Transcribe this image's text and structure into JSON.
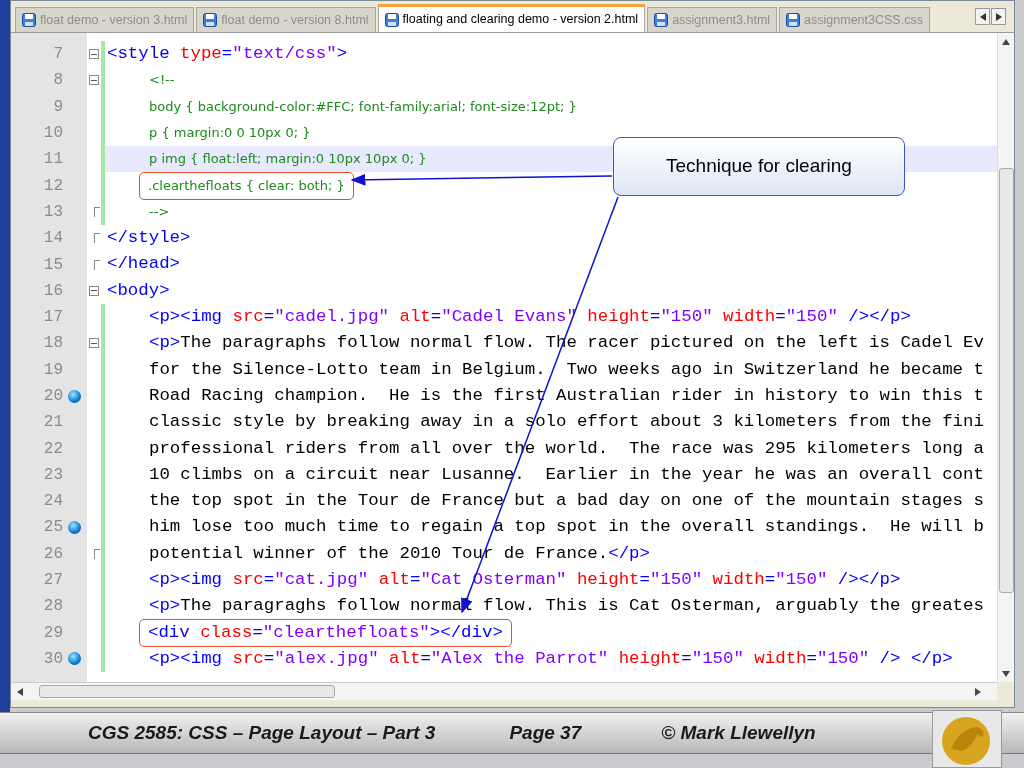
{
  "tabs": [
    {
      "label": "float demo - version 3.html",
      "selected": false
    },
    {
      "label": "float demo - version 8.html",
      "selected": false
    },
    {
      "label": "floating and clearing demo - version 2.html",
      "selected": true
    },
    {
      "label": "assignment3.html",
      "selected": false
    },
    {
      "label": "assignment3CSS.css",
      "selected": false
    }
  ],
  "lines": [
    {
      "number": "7",
      "fold_start": true,
      "fold_end": false,
      "bookmark": false,
      "changed": true,
      "current": false,
      "boxed": false,
      "indented": false,
      "tokens": [
        {
          "kind": "tag",
          "text": "<style "
        },
        {
          "kind": "attr",
          "text": "type"
        },
        {
          "kind": "tag",
          "text": "="
        },
        {
          "kind": "value",
          "text": "\"text/css\""
        },
        {
          "kind": "tag",
          "text": ">"
        }
      ]
    },
    {
      "number": "8",
      "fold_start": true,
      "fold_end": false,
      "bookmark": false,
      "changed": true,
      "current": false,
      "boxed": false,
      "indented": true,
      "tokens": [
        {
          "kind": "css",
          "text": "<!--"
        }
      ]
    },
    {
      "number": "9",
      "fold_start": false,
      "fold_end": false,
      "bookmark": false,
      "changed": true,
      "current": false,
      "boxed": false,
      "indented": true,
      "tokens": [
        {
          "kind": "css",
          "text": "body { background-color:#FFC; font-family:arial; font-size:12pt; }"
        }
      ]
    },
    {
      "number": "10",
      "fold_start": false,
      "fold_end": false,
      "bookmark": false,
      "changed": true,
      "current": false,
      "boxed": false,
      "indented": true,
      "tokens": [
        {
          "kind": "css",
          "text": "p { margin:0 0 10px 0; }"
        }
      ]
    },
    {
      "number": "11",
      "fold_start": false,
      "fold_end": false,
      "bookmark": false,
      "changed": true,
      "current": true,
      "boxed": false,
      "indented": true,
      "tokens": [
        {
          "kind": "css",
          "text": "p img { float:left; margin:0 10px 10px 0; }"
        }
      ]
    },
    {
      "number": "12",
      "fold_start": false,
      "fold_end": false,
      "bookmark": false,
      "changed": true,
      "current": false,
      "boxed": true,
      "indented": true,
      "tokens": [
        {
          "kind": "css",
          "text": ".clearthefloats { clear: both; }"
        }
      ]
    },
    {
      "number": "13",
      "fold_start": false,
      "fold_end": true,
      "bookmark": false,
      "changed": true,
      "current": false,
      "boxed": false,
      "indented": true,
      "tokens": [
        {
          "kind": "css",
          "text": "-->"
        }
      ]
    },
    {
      "number": "14",
      "fold_start": false,
      "fold_end": true,
      "bookmark": false,
      "changed": false,
      "current": false,
      "boxed": false,
      "indented": false,
      "tokens": [
        {
          "kind": "tag",
          "text": "</style>"
        }
      ]
    },
    {
      "number": "15",
      "fold_start": false,
      "fold_end": true,
      "bookmark": false,
      "changed": false,
      "current": false,
      "boxed": false,
      "indented": false,
      "tokens": [
        {
          "kind": "tag",
          "text": "</head>"
        }
      ]
    },
    {
      "number": "16",
      "fold_start": true,
      "fold_end": false,
      "bookmark": false,
      "changed": false,
      "current": false,
      "boxed": false,
      "indented": false,
      "tokens": [
        {
          "kind": "tag",
          "text": "<body>"
        }
      ]
    },
    {
      "number": "17",
      "fold_start": false,
      "fold_end": false,
      "bookmark": false,
      "changed": true,
      "current": false,
      "boxed": false,
      "indented": true,
      "tokens": [
        {
          "kind": "tag",
          "text": "<p><img "
        },
        {
          "kind": "attr",
          "text": "src"
        },
        {
          "kind": "tag",
          "text": "="
        },
        {
          "kind": "value",
          "text": "\"cadel.jpg\" "
        },
        {
          "kind": "attr",
          "text": "alt"
        },
        {
          "kind": "tag",
          "text": "="
        },
        {
          "kind": "value",
          "text": "\"Cadel Evans\" "
        },
        {
          "kind": "attr",
          "text": "height"
        },
        {
          "kind": "tag",
          "text": "="
        },
        {
          "kind": "value",
          "text": "\"150\" "
        },
        {
          "kind": "attr",
          "text": "width"
        },
        {
          "kind": "tag",
          "text": "="
        },
        {
          "kind": "value",
          "text": "\"150\" "
        },
        {
          "kind": "tag",
          "text": "/></p>"
        }
      ]
    },
    {
      "number": "18",
      "fold_start": true,
      "fold_end": false,
      "bookmark": false,
      "changed": true,
      "current": false,
      "boxed": false,
      "indented": true,
      "tokens": [
        {
          "kind": "tag",
          "text": "<p>"
        },
        {
          "kind": "text",
          "text": "The paragraphs follow normal flow. The racer pictured on the left is Cadel Ev"
        }
      ]
    },
    {
      "number": "19",
      "fold_start": false,
      "fold_end": false,
      "bookmark": false,
      "changed": true,
      "current": false,
      "boxed": false,
      "indented": true,
      "tokens": [
        {
          "kind": "text",
          "text": "for the Silence-Lotto team in Belgium.  Two weeks ago in Switzerland he became t"
        }
      ]
    },
    {
      "number": "20",
      "fold_start": false,
      "fold_end": false,
      "bookmark": true,
      "changed": true,
      "current": false,
      "boxed": false,
      "indented": true,
      "tokens": [
        {
          "kind": "text",
          "text": "Road Racing champion.  He is the first Australian rider in history to win this t"
        }
      ]
    },
    {
      "number": "21",
      "fold_start": false,
      "fold_end": false,
      "bookmark": false,
      "changed": true,
      "current": false,
      "boxed": false,
      "indented": true,
      "tokens": [
        {
          "kind": "text",
          "text": "classic style by breaking away in a solo effort about 3 kilometers from the fini"
        }
      ]
    },
    {
      "number": "22",
      "fold_start": false,
      "fold_end": false,
      "bookmark": false,
      "changed": true,
      "current": false,
      "boxed": false,
      "indented": true,
      "tokens": [
        {
          "kind": "text",
          "text": "professional riders from all over the world.  The race was 295 kilometers long a"
        }
      ]
    },
    {
      "number": "23",
      "fold_start": false,
      "fold_end": false,
      "bookmark": false,
      "changed": true,
      "current": false,
      "boxed": false,
      "indented": true,
      "tokens": [
        {
          "kind": "text",
          "text": "10 climbs on a circuit near Lusanne.  Earlier in the year he was an overall cont"
        }
      ]
    },
    {
      "number": "24",
      "fold_start": false,
      "fold_end": false,
      "bookmark": false,
      "changed": true,
      "current": false,
      "boxed": false,
      "indented": true,
      "tokens": [
        {
          "kind": "text",
          "text": "the top spot in the Tour de France but a bad day on one of the mountain stages s"
        }
      ]
    },
    {
      "number": "25",
      "fold_start": false,
      "fold_end": false,
      "bookmark": true,
      "changed": true,
      "current": false,
      "boxed": false,
      "indented": true,
      "tokens": [
        {
          "kind": "text",
          "text": "him lose too much time to regain a top spot in the overall standings.  He will b"
        }
      ]
    },
    {
      "number": "26",
      "fold_start": false,
      "fold_end": true,
      "bookmark": false,
      "changed": true,
      "current": false,
      "boxed": false,
      "indented": true,
      "tokens": [
        {
          "kind": "text",
          "text": "potential winner of the 2010 Tour de France."
        },
        {
          "kind": "tag",
          "text": "</p>"
        }
      ]
    },
    {
      "number": "27",
      "fold_start": false,
      "fold_end": false,
      "bookmark": false,
      "changed": true,
      "current": false,
      "boxed": false,
      "indented": true,
      "tokens": [
        {
          "kind": "tag",
          "text": "<p><img "
        },
        {
          "kind": "attr",
          "text": "src"
        },
        {
          "kind": "tag",
          "text": "="
        },
        {
          "kind": "value",
          "text": "\"cat.jpg\" "
        },
        {
          "kind": "attr",
          "text": "alt"
        },
        {
          "kind": "tag",
          "text": "="
        },
        {
          "kind": "value",
          "text": "\"Cat Osterman\" "
        },
        {
          "kind": "attr",
          "text": "height"
        },
        {
          "kind": "tag",
          "text": "="
        },
        {
          "kind": "value",
          "text": "\"150\" "
        },
        {
          "kind": "attr",
          "text": "width"
        },
        {
          "kind": "tag",
          "text": "="
        },
        {
          "kind": "value",
          "text": "\"150\" "
        },
        {
          "kind": "tag",
          "text": "/></p>"
        }
      ]
    },
    {
      "number": "28",
      "fold_start": false,
      "fold_end": false,
      "bookmark": false,
      "changed": true,
      "current": false,
      "boxed": false,
      "indented": true,
      "tokens": [
        {
          "kind": "tag",
          "text": "<p>"
        },
        {
          "kind": "text",
          "text": "The paragraghs follow normal flow. This is Cat Osterman, arguably the greates"
        }
      ]
    },
    {
      "number": "29",
      "fold_start": false,
      "fold_end": false,
      "bookmark": false,
      "changed": true,
      "current": false,
      "boxed": true,
      "indented": true,
      "tokens": [
        {
          "kind": "tag",
          "text": "<div "
        },
        {
          "kind": "attr",
          "text": "class"
        },
        {
          "kind": "tag",
          "text": "="
        },
        {
          "kind": "value",
          "text": "\"clearthefloats\""
        },
        {
          "kind": "tag",
          "text": "></div>"
        }
      ]
    },
    {
      "number": "30",
      "fold_start": false,
      "fold_end": false,
      "bookmark": true,
      "changed": true,
      "current": false,
      "boxed": false,
      "indented": true,
      "tokens": [
        {
          "kind": "tag",
          "text": "<p><img "
        },
        {
          "kind": "attr",
          "text": "src"
        },
        {
          "kind": "tag",
          "text": "="
        },
        {
          "kind": "value",
          "text": "\"alex.jpg\" "
        },
        {
          "kind": "attr",
          "text": "alt"
        },
        {
          "kind": "tag",
          "text": "="
        },
        {
          "kind": "value",
          "text": "\"Alex the Parrot\" "
        },
        {
          "kind": "attr",
          "text": "height"
        },
        {
          "kind": "tag",
          "text": "="
        },
        {
          "kind": "value",
          "text": "\"150\" "
        },
        {
          "kind": "attr",
          "text": "width"
        },
        {
          "kind": "tag",
          "text": "="
        },
        {
          "kind": "value",
          "text": "\"150\" "
        },
        {
          "kind": "tag",
          "text": "/> </p>"
        }
      ]
    }
  ],
  "callout": {
    "text": "Technique for clearing"
  },
  "footer": {
    "course": "CGS 2585: CSS – Page Layout – Part 3",
    "page": "Page 37",
    "author": "© Mark Llewellyn"
  }
}
